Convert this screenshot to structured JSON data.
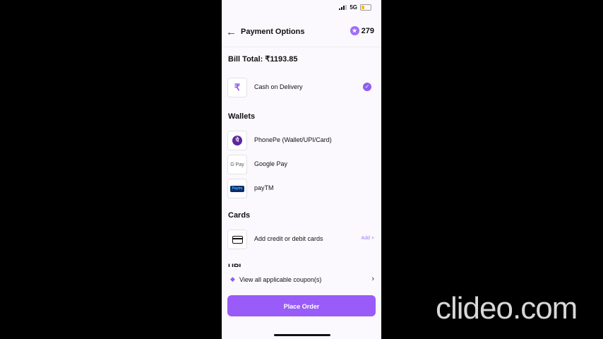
{
  "status_bar": {
    "network": "5G"
  },
  "header": {
    "title": "Payment Options",
    "coins": "279",
    "back_icon": "back-arrow-icon",
    "coin_icon": "star-coin-icon"
  },
  "bill_total": "Bill Total: ₹1193.85",
  "cash_on_delivery": {
    "label": "Cash on Delivery",
    "icon": "₹",
    "selected": true
  },
  "wallets": {
    "title": "Wallets",
    "items": [
      {
        "label": "PhonePe (Wallet/UPI/Card)",
        "icon": "phonepe-logo",
        "glyph": "पे"
      },
      {
        "label": "Google Pay",
        "icon": "gpay-logo",
        "glyph": "G Pay"
      },
      {
        "label": "payTM",
        "icon": "paytm-logo",
        "glyph": "Paytm"
      }
    ]
  },
  "cards": {
    "title": "Cards",
    "add_card_label": "Add credit or debit cards",
    "add_label": "Add +"
  },
  "next_section_partial": "UPI",
  "coupon": {
    "label": "View all applicable coupon(s)"
  },
  "place_order": {
    "label": "Place Order"
  },
  "colors": {
    "accent": "#9a5cf8",
    "background": "#fbf9fd"
  },
  "watermark": "clideo.com"
}
